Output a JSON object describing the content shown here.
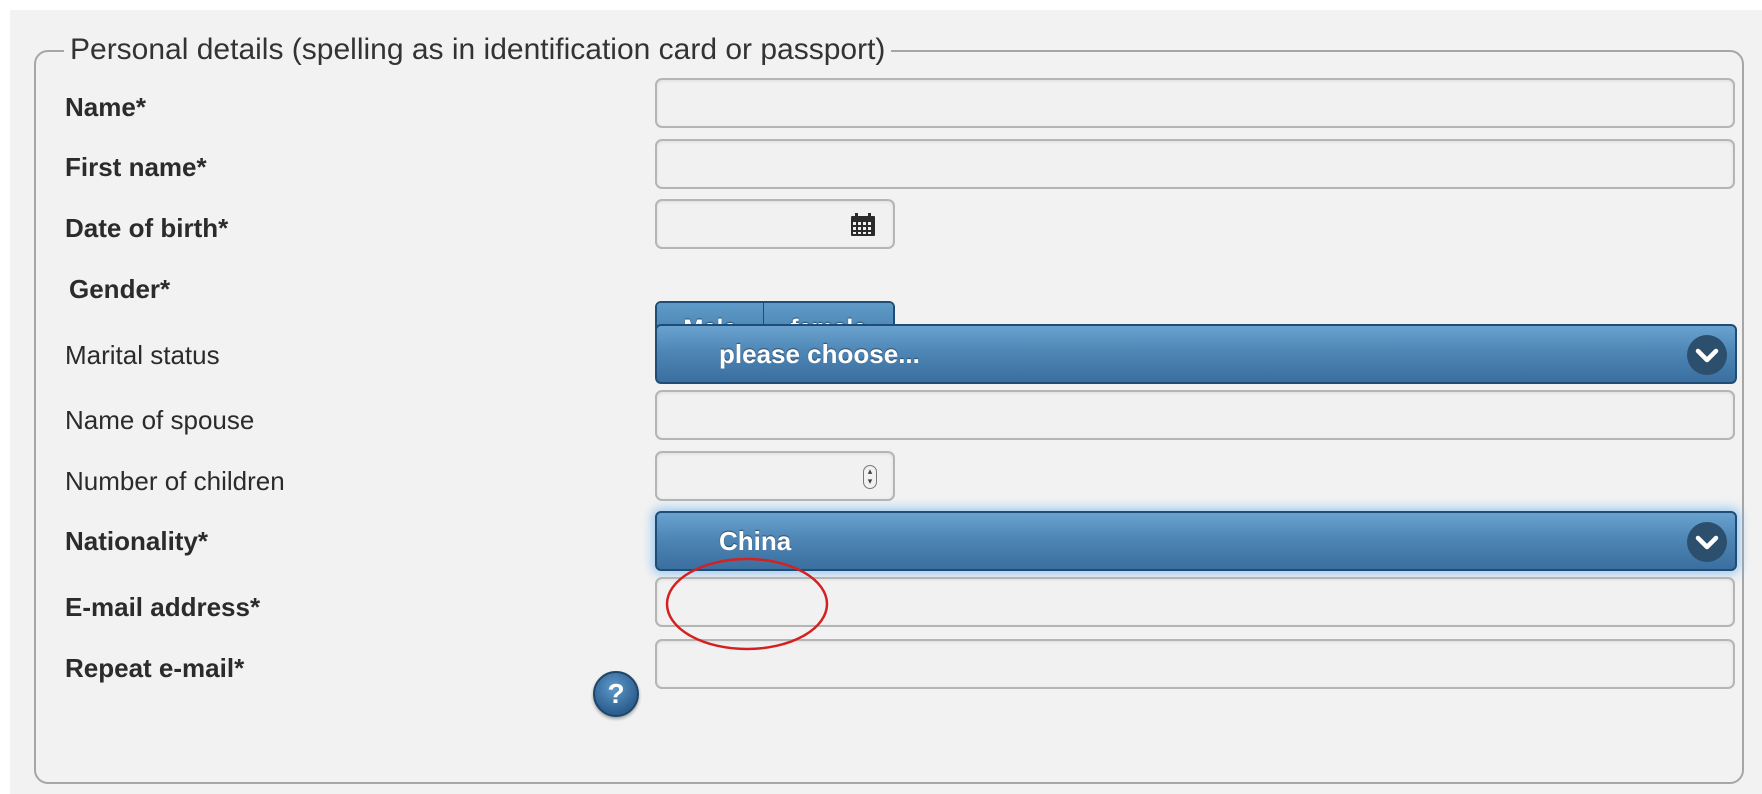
{
  "section": {
    "legend": "Personal details (spelling as in identification card or passport)"
  },
  "fields": {
    "name": {
      "label": "Name*",
      "value": ""
    },
    "first_name": {
      "label": "First name*",
      "value": ""
    },
    "date_of_birth": {
      "label": "Date of birth*",
      "value": "",
      "icon": "calendar-icon"
    },
    "gender": {
      "label": "Gender*",
      "options": [
        "Male",
        "female"
      ]
    },
    "marital_status": {
      "label": "Marital status",
      "selected": "please choose..."
    },
    "name_of_spouse": {
      "label": "Name of spouse",
      "value": ""
    },
    "number_of_children": {
      "label": "Number of children",
      "value": "",
      "icon": "spinner-icon"
    },
    "nationality": {
      "label": "Nationality*",
      "selected": "China"
    },
    "email": {
      "label": "E-mail address*",
      "value": "",
      "help_icon": "?"
    },
    "repeat_email": {
      "label": "Repeat e-mail*",
      "value": ""
    }
  },
  "colors": {
    "accent": "#4e86b6",
    "accent_dark": "#1f4d75",
    "annotation": "#d42020",
    "background": "#f2f2f2"
  }
}
